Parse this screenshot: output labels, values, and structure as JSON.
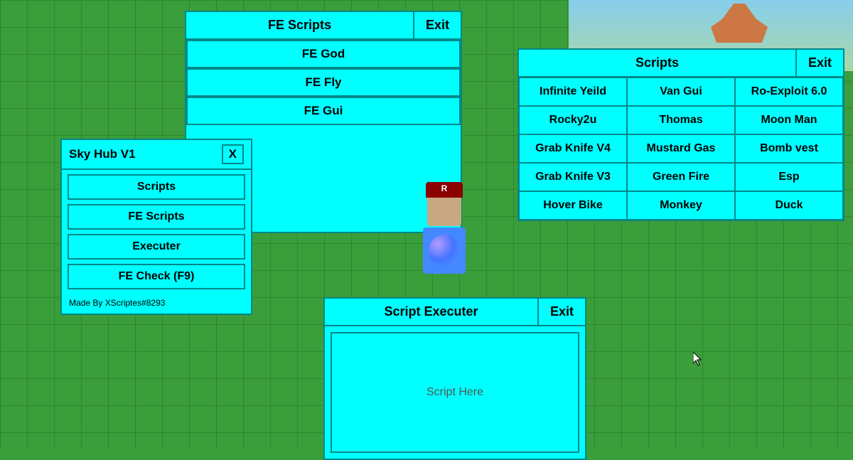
{
  "background": {
    "color": "#3a9e3a"
  },
  "fe_scripts_panel": {
    "title": "FE Scripts",
    "exit_label": "Exit",
    "buttons": [
      {
        "label": "FE God"
      },
      {
        "label": "FE Fly"
      },
      {
        "label": "FE Gui"
      }
    ]
  },
  "sky_hub_panel": {
    "title": "Sky Hub V1",
    "x_label": "X",
    "buttons": [
      {
        "label": "Scripts"
      },
      {
        "label": "FE Scripts"
      },
      {
        "label": "Executer"
      },
      {
        "label": "FE Check (F9)"
      }
    ],
    "footer": "Made By XScriptes#8293"
  },
  "scripts_panel": {
    "title": "Scripts",
    "exit_label": "Exit",
    "grid_buttons": [
      "Infinite Yeild",
      "Van Gui",
      "Ro-Exploit 6.0",
      "Rocky2u",
      "Thomas",
      "Moon Man",
      "Grab Knife V4",
      "Mustard Gas",
      "Bomb vest",
      "Grab Knife V3",
      "Green Fire",
      "Esp",
      "Hover Bike",
      "Monkey",
      "Duck"
    ]
  },
  "executer_panel": {
    "title": "Script Executer",
    "exit_label": "Exit",
    "placeholder": "Script Here"
  }
}
